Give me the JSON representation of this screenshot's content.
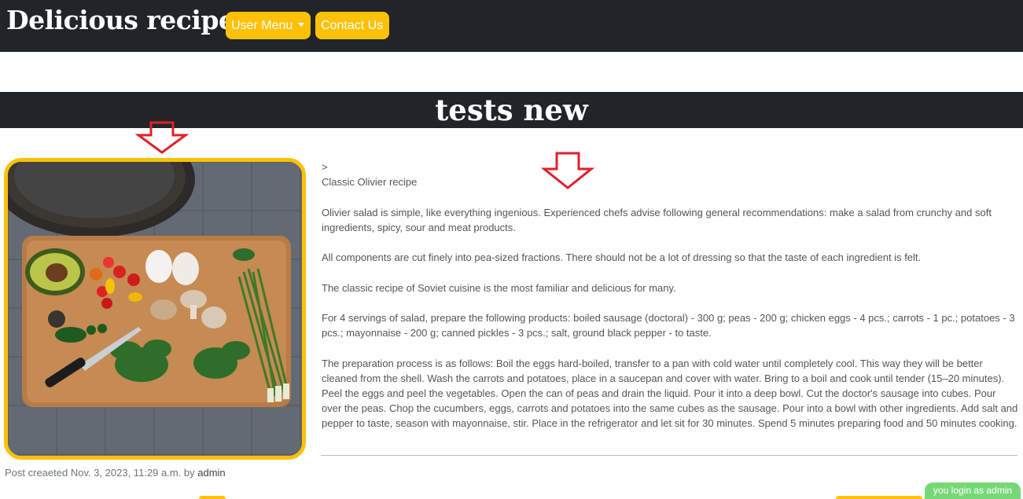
{
  "header": {
    "brand": "Delicious recipes",
    "nav": {
      "user_menu": "User Menu",
      "contact": "Contact Us"
    }
  },
  "page": {
    "title": "tests new"
  },
  "post": {
    "image_alt": "Cutting board with avocado, cherry tomatoes, eggs, mushrooms, spinach, green onions and a knife",
    "breadcrumb": ">",
    "heading": "Classic Olivier recipe",
    "paragraphs": [
      "Olivier salad is simple, like everything ingenious. Experienced chefs advise following general recommendations: make a salad from crunchy and soft ingredients, spicy, sour and meat products.",
      "All components are cut finely into pea-sized fractions. There should not be a lot of dressing so that the taste of each ingredient is felt.",
      "The classic recipe of Soviet cuisine is the most familiar and delicious for many.",
      "For 4 servings of salad, prepare the following products: boiled sausage (doctoral) - 300 g; peas - 200 g; chicken eggs - 4 pcs.; carrots - 1 pc.; potatoes - 3 pcs.; mayonnaise - 200 g; canned pickles - 3 pcs.; salt, ground black pepper - to taste.",
      "The preparation process is as follows: Boil the eggs hard-boiled, transfer to a pan with cold water until completely cool. This way they will be better cleaned from the shell. Wash the carrots and potatoes, place in a saucepan and cover with water. Bring to a boil and cook until tender (15–20 minutes). Peel the eggs and peel the vegetables. Open the can of peas and drain the liquid. Pour it into a deep bowl. Cut the doctor's sausage into cubes. Pour over the peas. Chop the cucumbers, eggs, carrots and potatoes into the same cubes as the sausage. Pour into a bowl with other ingredients. Add salt and pepper to taste, season with mayonnaise, stir. Place in the refrigerator and let sit for 30 minutes. Spend 5 minutes preparing food and 50 minutes cooking."
    ],
    "meta_prefix": "Post creaeted Nov. 3, 2023, 11:29 a.m. by",
    "author": "admin"
  },
  "status": {
    "login_badge": "you login as admin"
  },
  "colors": {
    "navbar": "#212529",
    "accent": "#ffc107",
    "arrow": "#e0202a",
    "badge": "#78d878"
  }
}
